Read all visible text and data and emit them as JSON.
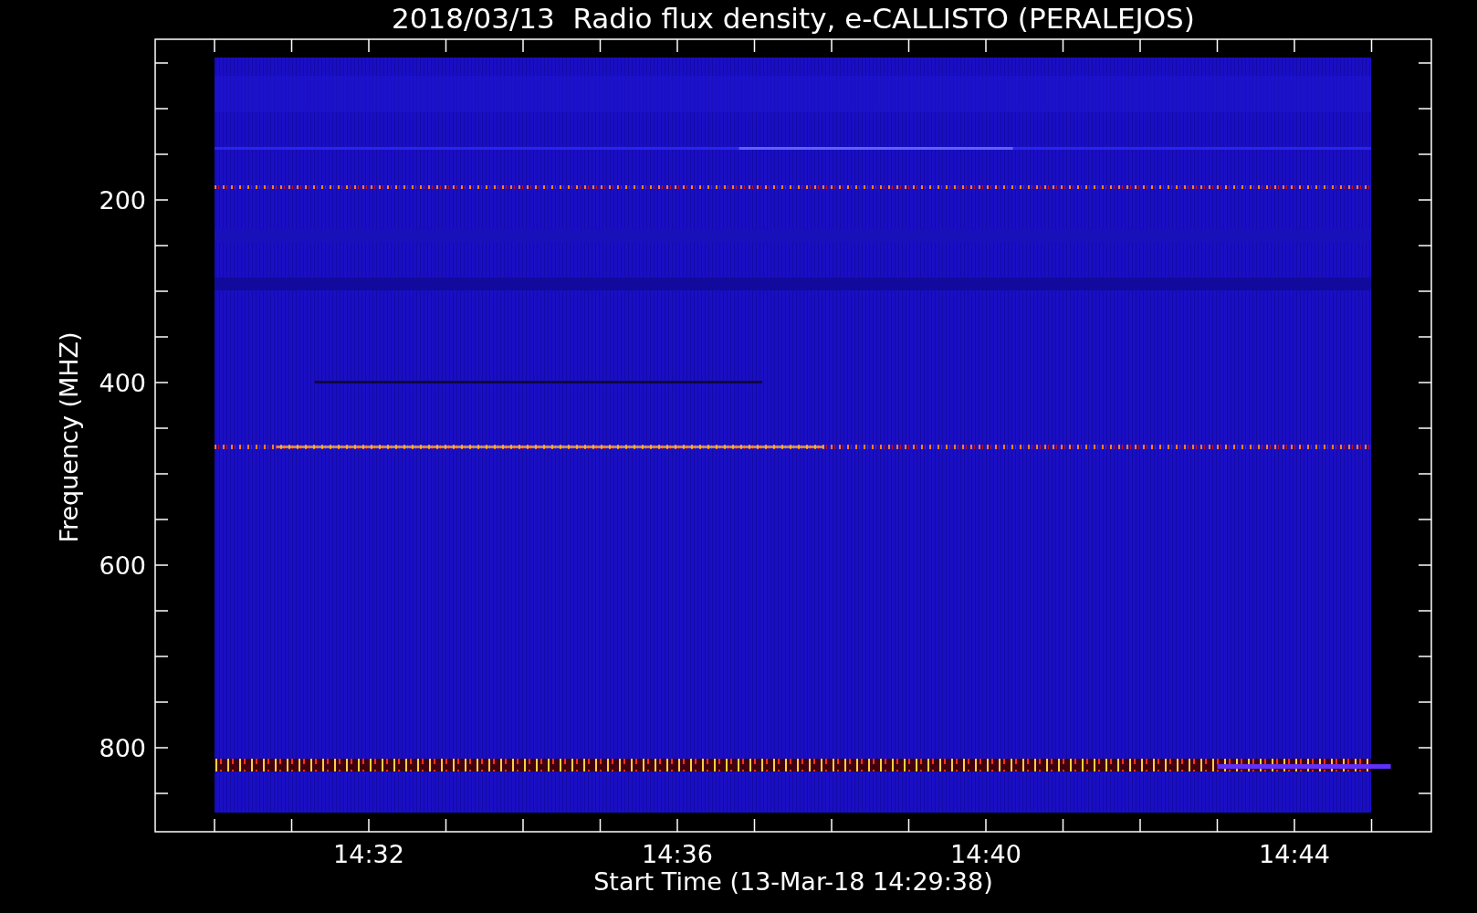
{
  "title": "2018/03/13  Radio flux density, e-CALLISTO (PERALEJOS)",
  "y_axis": {
    "label": "Frequency (MHZ)",
    "ticks": [
      "200",
      "400",
      "600",
      "800"
    ]
  },
  "x_axis": {
    "label": "Start Time (13-Mar-18 14:29:38)",
    "ticks": [
      "14:32",
      "14:36",
      "14:40",
      "14:44"
    ]
  }
}
